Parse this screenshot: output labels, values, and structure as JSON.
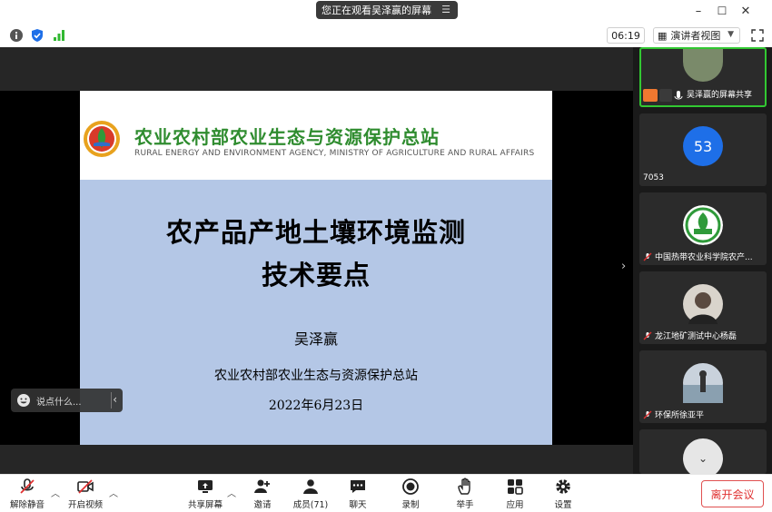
{
  "window": {
    "share_banner": "您正在观看吴泽赢的屏幕",
    "minimize_glyph": "–",
    "maximize_glyph": "☐",
    "close_glyph": "✕"
  },
  "toolbar": {
    "time": "06:19",
    "view_mode": "演讲者视图"
  },
  "slide": {
    "org_cn": "农业农村部农业生态与资源保护总站",
    "org_en": "RURAL ENERGY AND ENVIRONMENT AGENCY, MINISTRY OF AGRICULTURE AND RURAL AFFAIRS",
    "title_line1": "农产品产地土壤环境监测",
    "title_line2": "技术要点",
    "author": "吴泽赢",
    "organization": "农业农村部农业生态与资源保护总站",
    "date": "2022年6月23日"
  },
  "chat": {
    "placeholder": "说点什么..."
  },
  "participants": [
    {
      "name": "吴泽赢的屏幕共享"
    },
    {
      "name": "7053",
      "avatar_text": "53",
      "avatar_color": "#1e6fe8"
    },
    {
      "name": "中国热带农业科学院农产..."
    },
    {
      "name": "龙江地矿测试中心杨磊"
    },
    {
      "name": "环保所徐亚平"
    }
  ],
  "controls": {
    "unmute": "解除静音",
    "start_video": "开启视频",
    "share_screen": "共享屏幕",
    "invite": "邀请",
    "members": "成员(71)",
    "chat": "聊天",
    "record": "录制",
    "raise_hand": "举手",
    "apps": "应用",
    "settings": "设置",
    "leave": "离开会议"
  },
  "colors": {
    "accent_green": "#32c832",
    "leave_red": "#e03030",
    "slide_bg": "#b4c7e6",
    "org_green": "#2f8c2f"
  }
}
